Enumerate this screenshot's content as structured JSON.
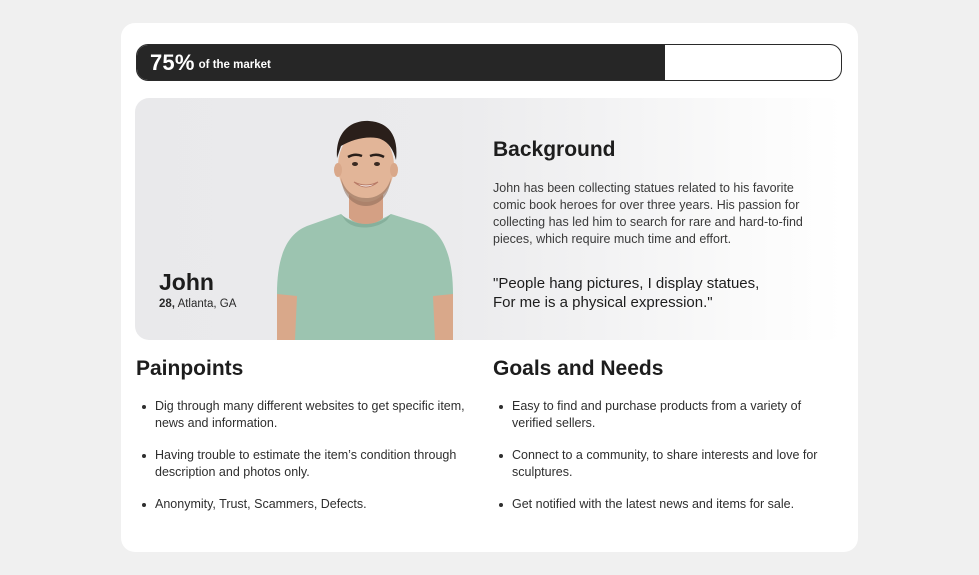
{
  "progress": {
    "percent_label": "75%",
    "suffix": "of the market",
    "fraction": 0.75
  },
  "persona": {
    "name": "John",
    "age": "28,",
    "location": "Atlanta, GA"
  },
  "background": {
    "title": "Background",
    "text": "John has been collecting statues related to his favorite comic book heroes for over three years. His passion for collecting has led him to search for rare and hard-to-find pieces, which require much time and effort.",
    "quote_line1": "\"People hang pictures, I display statues,",
    "quote_line2": "For me is a physical expression.\""
  },
  "painpoints": {
    "title": "Painpoints",
    "items": [
      "Dig through many different websites to get specific item, news and information.",
      "Having trouble to estimate the item’s condition through description and photos only.",
      "Anonymity, Trust, Scammers, Defects."
    ]
  },
  "goals": {
    "title": "Goals and Needs",
    "items": [
      "Easy to find and purchase products from a variety of verified sellers.",
      "Connect to a community, to share interests and love for sculptures.",
      "Get notified with the latest news and items for sale."
    ]
  },
  "colors": {
    "page_bg": "#f0f0f0",
    "card_bg": "#ffffff",
    "progress_fill": "#262626",
    "shirt": "#9cc4b0"
  }
}
